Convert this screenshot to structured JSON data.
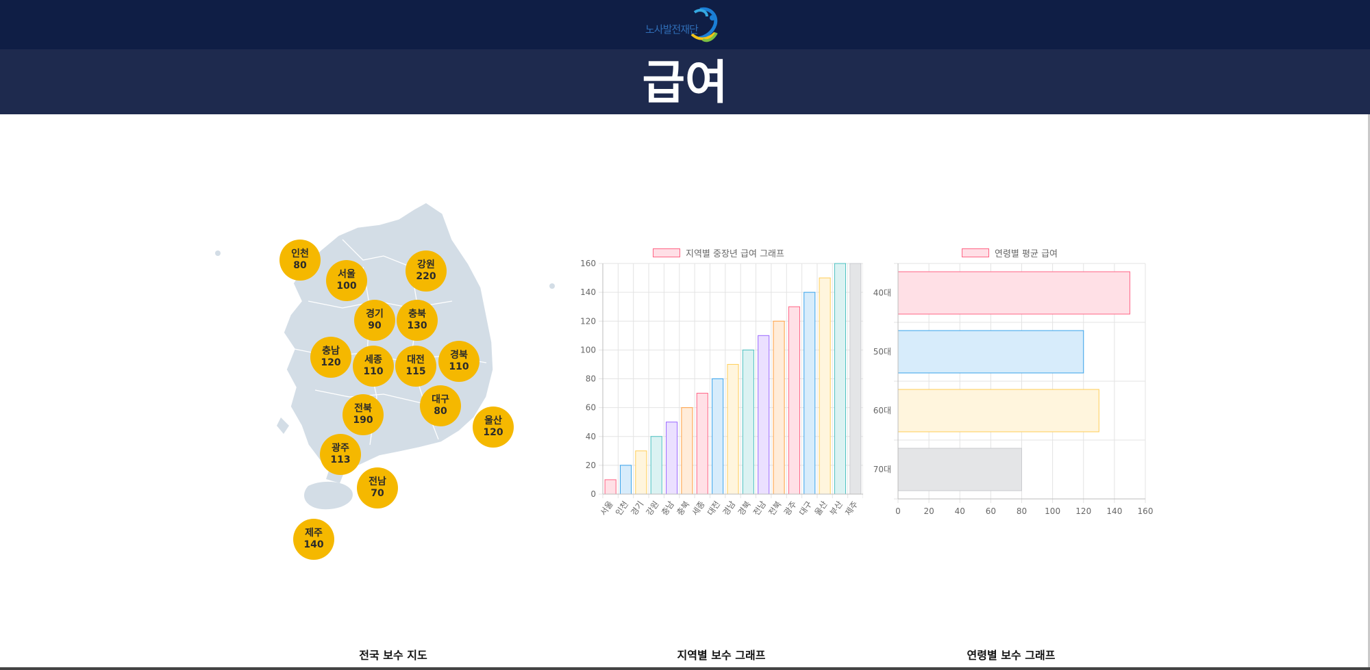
{
  "header": {
    "logo_text": "노사발전재단",
    "title": "급여"
  },
  "map": {
    "regions": [
      {
        "name": "인천",
        "value": "80"
      },
      {
        "name": "서울",
        "value": "100"
      },
      {
        "name": "강원",
        "value": "220"
      },
      {
        "name": "경기",
        "value": "90"
      },
      {
        "name": "충북",
        "value": "130"
      },
      {
        "name": "충남",
        "value": "120"
      },
      {
        "name": "세종",
        "value": "110"
      },
      {
        "name": "대전",
        "value": "115"
      },
      {
        "name": "경북",
        "value": "110"
      },
      {
        "name": "대구",
        "value": "80"
      },
      {
        "name": "전북",
        "value": "190"
      },
      {
        "name": "울산",
        "value": "120"
      },
      {
        "name": "광주",
        "value": "113"
      },
      {
        "name": "전남",
        "value": "70"
      },
      {
        "name": "제주",
        "value": "140"
      }
    ]
  },
  "captions": {
    "map": "전국 보수 지도",
    "region_chart": "지역별 보수 그래프",
    "age_chart": "연령별 보수 그래프"
  },
  "chart_data": [
    {
      "type": "bar",
      "legend": "지역별 중장년 급여 그래프",
      "categories": [
        "서울",
        "인천",
        "경기",
        "강원",
        "충남",
        "충북",
        "세종",
        "대전",
        "경남",
        "경북",
        "전남",
        "전북",
        "광주",
        "대구",
        "울산",
        "부산",
        "제주"
      ],
      "values": [
        10,
        20,
        30,
        40,
        50,
        60,
        70,
        80,
        90,
        100,
        110,
        120,
        130,
        140,
        150,
        160,
        null
      ],
      "ylim": [
        0,
        160
      ],
      "yticks": [
        "0",
        "20",
        "40",
        "60",
        "80",
        "100",
        "120",
        "140",
        "160"
      ],
      "grid": true
    },
    {
      "type": "bar",
      "orientation": "horizontal",
      "legend": "연령별 평균 급여",
      "categories": [
        "40대",
        "50대",
        "60대",
        "70대"
      ],
      "values": [
        150,
        120,
        130,
        80
      ],
      "xlim": [
        0,
        160
      ],
      "xticks": [
        "0",
        "20",
        "40",
        "60",
        "80",
        "100",
        "120",
        "140",
        "160"
      ],
      "grid": true
    }
  ],
  "colors": {
    "topbar": "#0f1e45",
    "hero": "#1e2a4e",
    "badge": "#f5b800",
    "map_fill": "#d3dde6",
    "bar_palette": [
      {
        "border": "#ff6384",
        "fill": "#ffe0e6"
      },
      {
        "border": "#36a2eb",
        "fill": "#d7ecfb"
      },
      {
        "border": "#ffcd56",
        "fill": "#fff5dd"
      },
      {
        "border": "#4bc0c0",
        "fill": "#dbf2f2"
      },
      {
        "border": "#9966ff",
        "fill": "#ebe0ff"
      },
      {
        "border": "#ff9f40",
        "fill": "#ffecd9"
      },
      {
        "border": "#c9cbcf",
        "fill": "#e4e5e7"
      }
    ]
  }
}
